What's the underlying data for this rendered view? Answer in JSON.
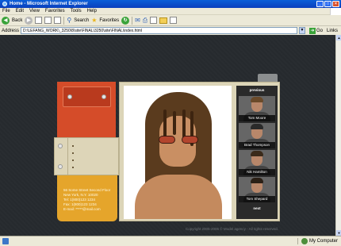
{
  "window": {
    "title": "Home - Microsoft Internet Explorer",
    "controls": [
      "_",
      "□",
      "×"
    ]
  },
  "menu": [
    "File",
    "Edit",
    "View",
    "Favorites",
    "Tools",
    "Help"
  ],
  "toolbar": {
    "back_label": "Back",
    "search_label": "Search",
    "favorites_label": "Favorites"
  },
  "address": {
    "label": "Address",
    "url": "D:\\LEFANG_WORK\\_3250\\8\\site\\FINAL\\3250\\site\\FINAL\\index.html",
    "go_label": "Go",
    "links_label": "Links"
  },
  "nav_menu": {
    "items": [
      "",
      "",
      "",
      ""
    ]
  },
  "contact": {
    "address_line1": "56 Some Street Second Floor",
    "address_line2": "New York, N.Y. 10020",
    "phone": "Tel: 1(800)123 1234",
    "fax": "Fax: 1(800)123 1234",
    "email": "E-mail: *****@mail.com"
  },
  "models": {
    "previous_label": "previous",
    "next_label": "next",
    "list": [
      {
        "name": "Tom Moore",
        "hair_color": "#6a4a2a",
        "shirt_color": "#3d3d3d"
      },
      {
        "name": "Brad Thompson",
        "hair_color": "#2a2a2a",
        "shirt_color": "#555555"
      },
      {
        "name": "Nik Hamilton",
        "hair_color": "#3a2a1a",
        "shirt_color": "#6b6b6b"
      },
      {
        "name": "Tom Shepard",
        "hair_color": "#2b2016",
        "shirt_color": "#4a4a4a"
      }
    ]
  },
  "footer": {
    "copyright": "Copyright 2005-2006 © Model agency - All rights reserved."
  },
  "status": {
    "text": "",
    "zone": "My Computer"
  },
  "colors": {
    "page_background": "#262a2e",
    "orange_panel": "#d54c29",
    "gold_panel": "#e5a52b",
    "cream_panel": "#ddd5b8"
  }
}
